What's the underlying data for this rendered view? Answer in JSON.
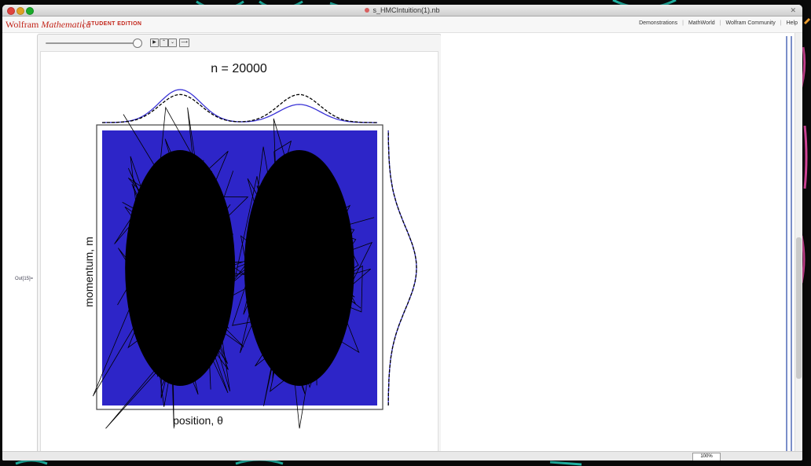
{
  "window": {
    "title": "s_HMCIntuition(1).nb",
    "close_glyph": "✕"
  },
  "brand": {
    "name_roman": "Wolfram",
    "name_italic": "Mathematica",
    "edition": "STUDENT EDITION"
  },
  "links": [
    "Demonstrations",
    "MathWorld",
    "Wolfram Community",
    "Help"
  ],
  "cell": {
    "out_label": "Out[15]="
  },
  "controls": {
    "slider_fraction": 0.97,
    "buttons": [
      "▶",
      "⌃",
      "⌄",
      "⟶"
    ]
  },
  "status": {
    "zoom": "100%"
  },
  "chart_data": {
    "type": "scatter",
    "title": "n = 20000",
    "xlabel": "position, θ",
    "ylabel": "momentum, m",
    "colors": {
      "background": "#2d25c8",
      "trace": "#000000",
      "marginal_solid": "#3a33d6",
      "marginal_dashed": "#000000"
    },
    "clusters": [
      {
        "center_x": -1.3,
        "center_y": 0.0
      },
      {
        "center_x": 1.3,
        "center_y": 0.0
      }
    ]
  }
}
